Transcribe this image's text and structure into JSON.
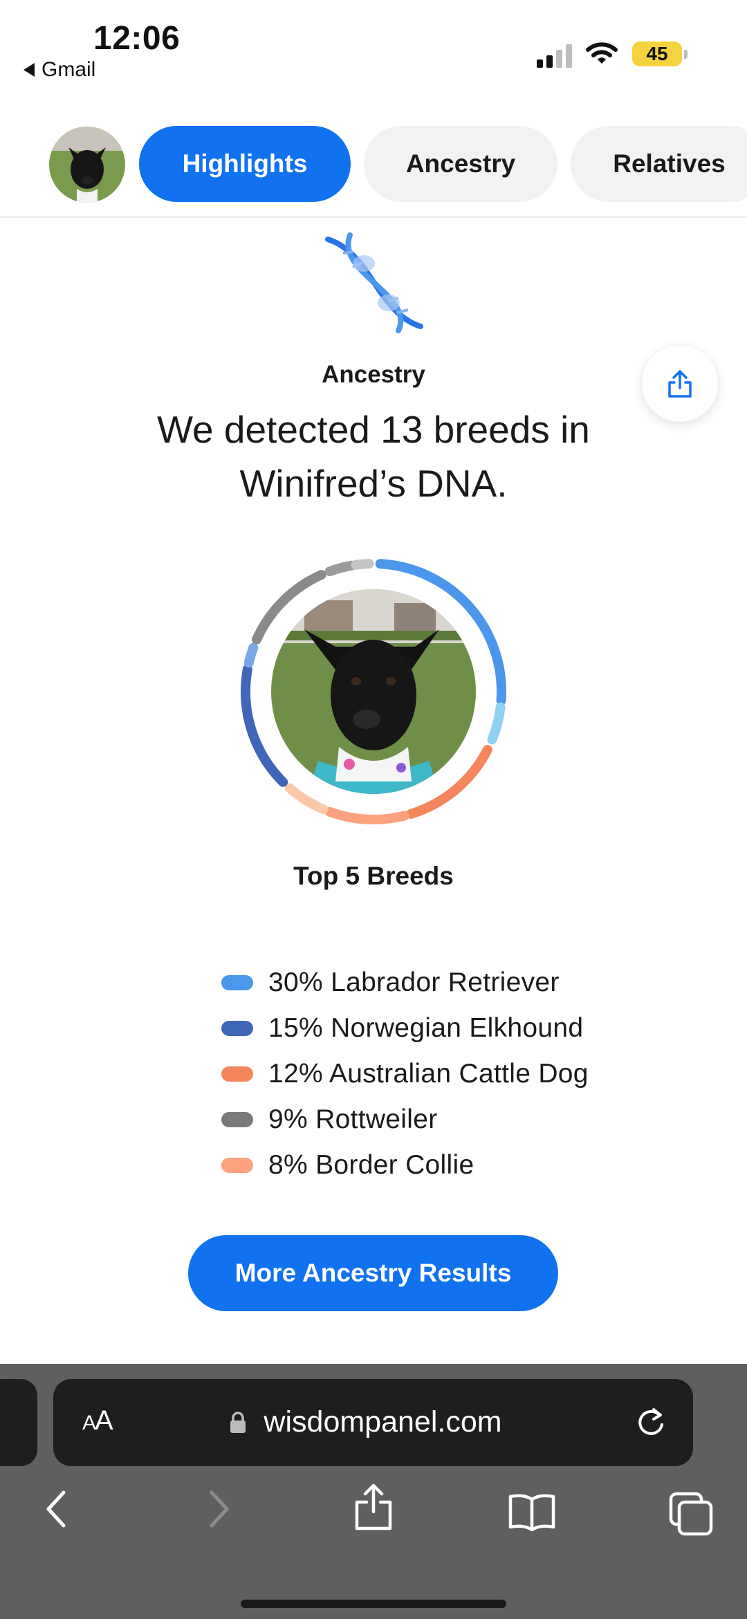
{
  "status_bar": {
    "time": "12:06",
    "back_label": "Gmail",
    "battery": "45"
  },
  "tabs": [
    {
      "label": "Highlights",
      "active": true
    },
    {
      "label": "Ancestry",
      "active": false
    },
    {
      "label": "Relatives",
      "active": false
    }
  ],
  "ancestry": {
    "section_label": "Ancestry",
    "headline": "We detected 13 breeds in Winifred’s DNA.",
    "top_label": "Top 5 Breeds",
    "breeds": [
      {
        "text": "30% Labrador Retriever",
        "color": "#4a97ec"
      },
      {
        "text": "15% Norwegian Elkhound",
        "color": "#3f66b8"
      },
      {
        "text": "12% Australian Cattle Dog",
        "color": "#f5855a"
      },
      {
        "text": "9% Rottweiler",
        "color": "#7a7a7a"
      },
      {
        "text": "8% Border Collie",
        "color": "#fca27f"
      }
    ],
    "more_button": "More Ancestry Results"
  },
  "browser": {
    "text_size_label": "AA",
    "url": "wisdompanel.com"
  },
  "colors": {
    "accent": "#1172f0"
  }
}
